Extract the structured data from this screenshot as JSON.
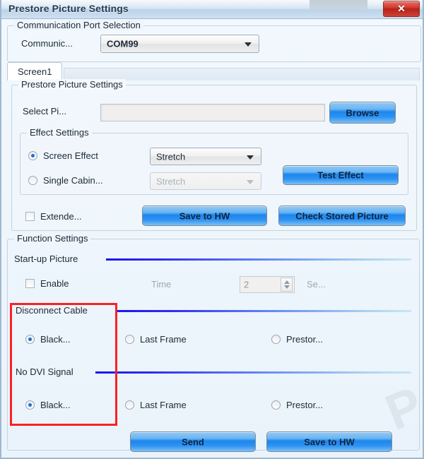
{
  "window": {
    "title": "Prestore Picture Settings",
    "close_label": "✕"
  },
  "comm_group": {
    "title": "Communication Port Selection",
    "port_label": "Communic...",
    "port_value": "COM99"
  },
  "tabs": [
    {
      "label": "Screen1",
      "active": true
    }
  ],
  "prestore_group": {
    "title": "Prestore Picture Settings",
    "select_label": "Select Pi...",
    "select_value": "",
    "browse_label": "Browse"
  },
  "effect_group": {
    "title": "Effect Settings",
    "screen_effect_label": "Screen Effect",
    "screen_effect_value": "Stretch",
    "screen_effect_selected": true,
    "single_cabinet_label": "Single Cabin...",
    "single_cabinet_value": "Stretch",
    "single_cabinet_selected": false,
    "test_effect_label": "Test Effect"
  },
  "prestore_actions": {
    "extended_label": "Extende...",
    "extended_checked": false,
    "save_to_hw_label": "Save to HW",
    "check_stored_label": "Check Stored Picture"
  },
  "function_group": {
    "title": "Function Settings",
    "startup": {
      "section_label": "Start-up Picture",
      "enable_label": "Enable",
      "enable_checked": false,
      "time_label": "Time",
      "time_value": "2",
      "unit_label": "Se..."
    },
    "disconnect_cable": {
      "section_label": "Disconnect Cable",
      "options": [
        {
          "label": "Black...",
          "selected": true
        },
        {
          "label": "Last Frame",
          "selected": false
        },
        {
          "label": "Prestor...",
          "selected": false
        }
      ]
    },
    "no_dvi_signal": {
      "section_label": "No DVI Signal",
      "options": [
        {
          "label": "Black...",
          "selected": true
        },
        {
          "label": "Last Frame",
          "selected": false
        },
        {
          "label": "Prestor...",
          "selected": false
        }
      ]
    }
  },
  "footer": {
    "send_label": "Send",
    "save_to_hw_label": "Save to HW"
  },
  "colors": {
    "accent_blue": "#1c86ee",
    "highlight_red": "#fb2121",
    "separator_blue": "#1b15f0",
    "titlebar_close_red": "#d0392e"
  }
}
